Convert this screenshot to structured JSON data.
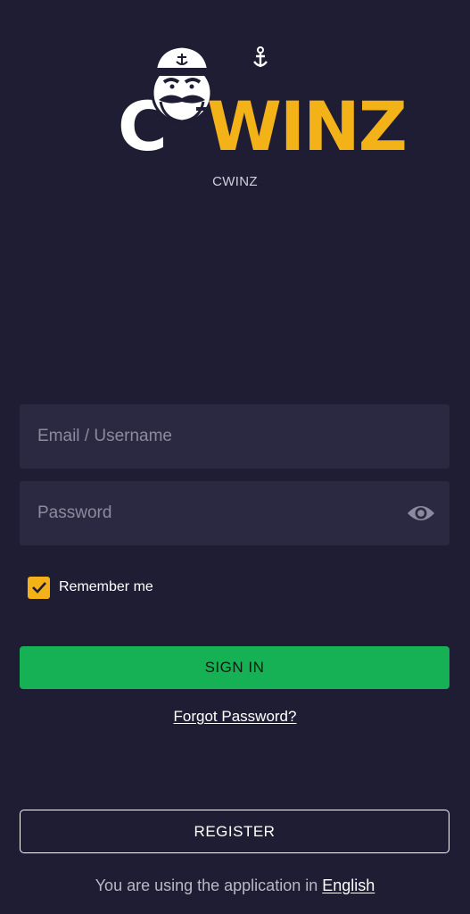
{
  "brand": {
    "logo_first": "C",
    "logo_rest": "WINZ",
    "caption": "CWINZ",
    "colors": {
      "background": "#1f1d33",
      "accent_yellow": "#f4b219",
      "signin_green": "#16b155",
      "field_bg": "#2a2941"
    }
  },
  "login": {
    "email": {
      "placeholder": "Email / Username",
      "value": ""
    },
    "password": {
      "placeholder": "Password",
      "value": "",
      "toggle_icon": "eye-icon"
    },
    "remember": {
      "label": "Remember me",
      "checked": true,
      "icon": "check-icon"
    },
    "signin_label": "SIGN IN",
    "forgot_label": "Forgot Password?"
  },
  "footer": {
    "register_label": "REGISTER",
    "language_prefix": "You are using the application in ",
    "language_name": "English"
  }
}
